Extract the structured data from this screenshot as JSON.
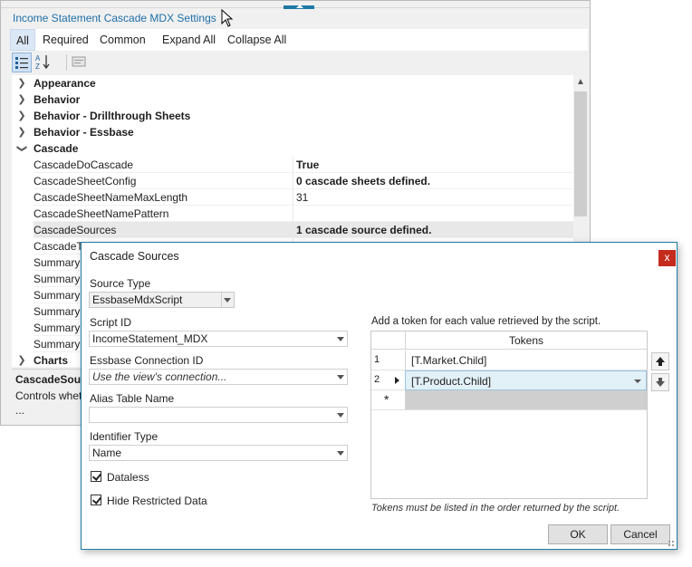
{
  "panel": {
    "title": "Income Statement Cascade MDX Settings",
    "filters": [
      "All",
      "Required",
      "Common",
      "Expand All",
      "Collapse All"
    ],
    "active_filter": "All",
    "toolbar": {
      "categorized_icon": "categorized-icon",
      "alphabetical_icon": "sort-az-icon",
      "pages_icon": "property-pages-icon"
    },
    "categories_top": [
      {
        "label": "Appearance",
        "expanded": false
      },
      {
        "label": "Behavior",
        "expanded": false
      },
      {
        "label": "Behavior - Drillthrough Sheets",
        "expanded": false
      },
      {
        "label": "Behavior - Essbase",
        "expanded": false
      },
      {
        "label": "Cascade",
        "expanded": true
      }
    ],
    "properties": [
      {
        "name": "CascadeDoCascade",
        "value": "True",
        "bold": true
      },
      {
        "name": "CascadeSheetConfig",
        "value": "0 cascade sheets defined.",
        "bold": true
      },
      {
        "name": "CascadeSheetNameMaxLength",
        "value": "31",
        "bold": false
      },
      {
        "name": "CascadeSheetNamePattern",
        "value": "",
        "bold": false
      },
      {
        "name": "CascadeSources",
        "value": "1 cascade source defined.",
        "bold": true
      },
      {
        "name": "CascadeTe",
        "value": "",
        "bold": false
      },
      {
        "name": "SummaryS",
        "value": "",
        "bold": false
      },
      {
        "name": "SummaryS",
        "value": "",
        "bold": false
      },
      {
        "name": "SummaryS",
        "value": "",
        "bold": false
      },
      {
        "name": "SummaryS",
        "value": "",
        "bold": false
      },
      {
        "name": "SummaryS",
        "value": "",
        "bold": false
      },
      {
        "name": "SummaryS",
        "value": "",
        "bold": false
      }
    ],
    "categories_bottom": [
      {
        "label": "Charts",
        "expanded": false
      }
    ],
    "description": {
      "title": "CascadeSource",
      "text": "Controls wheth",
      "more": "..."
    }
  },
  "dialog": {
    "title": "Cascade Sources",
    "close_label": "x",
    "source_type": {
      "label": "Source Type",
      "value": "EssbaseMdxScript"
    },
    "script_id": {
      "label": "Script ID",
      "value": "IncomeStatement_MDX"
    },
    "connection": {
      "label": "Essbase Connection ID",
      "value": "Use the view's connection..."
    },
    "alias_table": {
      "label": "Alias Table Name",
      "value": ""
    },
    "identifier_type": {
      "label": "Identifier Type",
      "value": "Name"
    },
    "dataless": {
      "label": "Dataless",
      "checked": true
    },
    "hide_restricted": {
      "label": "Hide Restricted Data",
      "checked": true
    },
    "tokens_instruction": "Add a token for each value retrieved by the script.",
    "tokens_header": "Tokens",
    "tokens": [
      {
        "num": "1",
        "value": "[T.Market.Child]"
      },
      {
        "num": "2",
        "value": "[T.Product.Child]"
      }
    ],
    "new_row_marker": "*",
    "move_up_icon": "arrow-up-icon",
    "move_down_icon": "arrow-down-icon",
    "tokens_note": "Tokens must be listed in the order returned by the script.",
    "ok_label": "OK",
    "cancel_label": "Cancel"
  }
}
